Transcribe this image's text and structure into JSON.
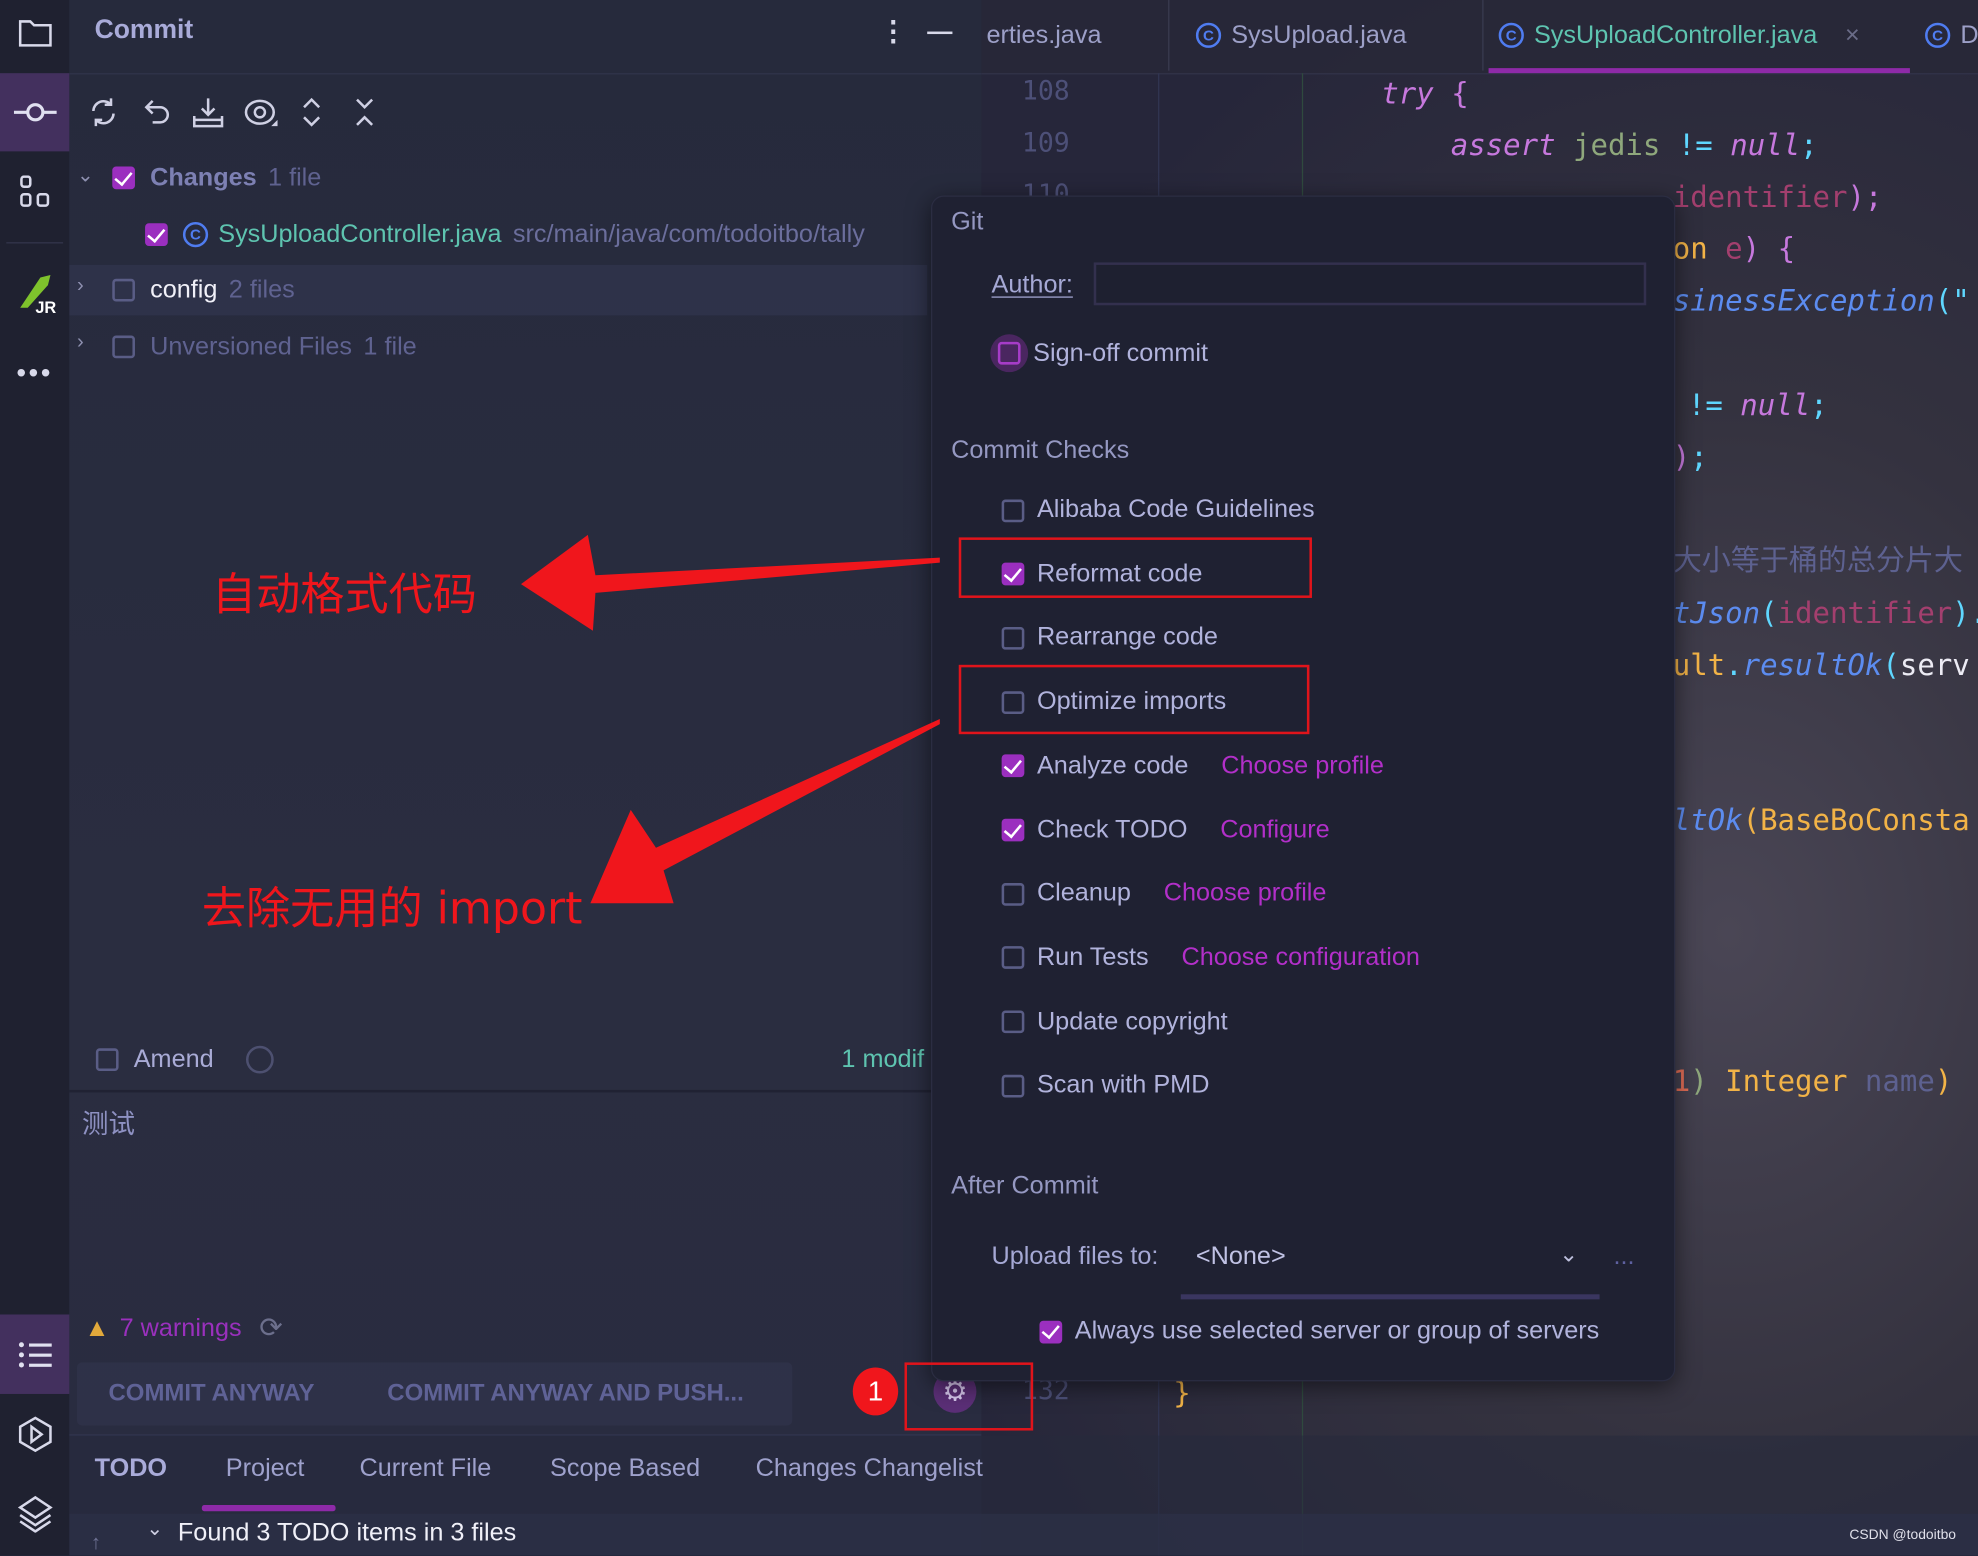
{
  "sidebar": {
    "icons": [
      "folder-icon",
      "commit-icon",
      "structure-icon",
      "jrebel-icon",
      "more-icon",
      "todo-list-icon",
      "run-icon",
      "layers-icon"
    ],
    "jr_label": "JR"
  },
  "commit_panel": {
    "title": "Commit",
    "toolbar": [
      "refresh-icon",
      "rollback-icon",
      "shelve-icon",
      "view-options-icon",
      "expand-all-icon",
      "collapse-all-icon"
    ],
    "tree": [
      {
        "name": "Changes",
        "count": "1 file",
        "checked": true,
        "expanded": true
      },
      {
        "name": "SysUploadController.java",
        "path": "src/main/java/com/todoitbo/tally",
        "checked": true
      },
      {
        "name": "config",
        "count": "2 files",
        "checked": false,
        "expanded": false
      },
      {
        "name": "Unversioned Files",
        "count": "1 file",
        "checked": false,
        "expanded": false
      }
    ],
    "amend_label": "Amend",
    "modified_summary": "1 modif",
    "message": "测试",
    "warnings": "7 warnings",
    "commit_anyway": "COMMIT ANYWAY",
    "commit_anyway_push": "COMMIT ANYWAY AND PUSH..."
  },
  "editor": {
    "tabs": [
      {
        "label": "erties.java",
        "active": false
      },
      {
        "label": "SysUpload.java",
        "active": false
      },
      {
        "label": "SysUploadController.java",
        "active": true
      },
      {
        "label": "D",
        "active": false
      }
    ],
    "line_numbers": [
      "108",
      "109",
      "110",
      "132"
    ],
    "lines": [
      [
        {
          "t": "try",
          "c": "kw"
        },
        {
          "t": " {",
          "c": "br"
        }
      ],
      [
        {
          "t": "assert",
          "c": "kw"
        },
        {
          "t": " jedis",
          "c": "var"
        },
        {
          "t": " !=",
          "c": "op"
        },
        {
          "t": " null",
          "c": "kw"
        },
        {
          "t": ";",
          "c": "op"
        }
      ],
      [
        {
          "t": "identifier",
          "c": "par"
        },
        {
          "t": ");",
          "c": "br"
        }
      ],
      [
        {
          "t": "on",
          "c": "cls"
        },
        {
          "t": " e",
          "c": "par"
        },
        {
          "t": ") {",
          "c": "br"
        }
      ],
      [
        {
          "t": "sinessException",
          "c": "fn"
        },
        {
          "t": "(\"",
          "c": "op"
        }
      ],
      [
        {
          "t": "!=",
          "c": "op"
        },
        {
          "t": " null",
          "c": "kw"
        },
        {
          "t": ";",
          "c": "op"
        }
      ],
      [
        {
          "t": ")",
          "c": "br"
        },
        {
          "t": ";",
          "c": "op"
        }
      ],
      [
        {
          "t": "大小等于桶的总分片大",
          "c": "cm"
        }
      ],
      [
        {
          "t": "tJson",
          "c": "fn"
        },
        {
          "t": "(",
          "c": "op"
        },
        {
          "t": "identifier",
          "c": "par"
        },
        {
          "t": ").",
          "c": "op"
        }
      ],
      [
        {
          "t": "ult",
          "c": "cls"
        },
        {
          "t": ".",
          "c": "op"
        },
        {
          "t": "resultOk",
          "c": "fn"
        },
        {
          "t": "(",
          "c": "op"
        },
        {
          "t": "serv",
          "c": "wh"
        }
      ],
      [
        {
          "t": "ltOk",
          "c": "fn"
        },
        {
          "t": "(BaseBoConsta",
          "c": "cls"
        }
      ],
      [
        {
          "t": "1",
          "c": "num"
        },
        {
          "t": ")",
          "c": "var"
        },
        {
          "t": " Integer",
          "c": "cls"
        },
        {
          "t": " name",
          "c": "cm"
        },
        {
          "t": ")",
          "c": "cls"
        }
      ],
      [
        {
          "t": "}",
          "c": "cls"
        }
      ]
    ]
  },
  "popup": {
    "git_title": "Git",
    "author_label": "Author:",
    "author_value": "",
    "signoff": {
      "label": "Sign-off commit",
      "checked": false
    },
    "checks_title": "Commit Checks",
    "checks": [
      {
        "label": "Alibaba Code Guidelines",
        "checked": false,
        "link": ""
      },
      {
        "label": "Reformat code",
        "checked": true,
        "link": ""
      },
      {
        "label": "Rearrange code",
        "checked": false,
        "link": ""
      },
      {
        "label": "Optimize imports",
        "checked": false,
        "link": ""
      },
      {
        "label": "Analyze code",
        "checked": true,
        "link": "Choose profile"
      },
      {
        "label": "Check TODO",
        "checked": true,
        "link": "Configure"
      },
      {
        "label": "Cleanup",
        "checked": false,
        "link": "Choose profile"
      },
      {
        "label": "Run Tests",
        "checked": false,
        "link": "Choose configuration"
      },
      {
        "label": "Update copyright",
        "checked": false,
        "link": ""
      },
      {
        "label": "Scan with PMD",
        "checked": false,
        "link": ""
      }
    ],
    "after_title": "After Commit",
    "upload_label": "Upload files to:",
    "upload_value": "<None>",
    "more_label": "...",
    "always_use": {
      "label": "Always use selected server or group of servers",
      "checked": true
    }
  },
  "annotations": {
    "reformat_note": "自动格式代码",
    "imports_note": "去除无用的 import",
    "badge": "1",
    "color": "#f0161c"
  },
  "bottom": {
    "tabs": [
      {
        "label": "TODO",
        "bold": true
      },
      {
        "label": "Project",
        "active": true
      },
      {
        "label": "Current File"
      },
      {
        "label": "Scope Based"
      },
      {
        "label": "Changes Changelist"
      }
    ],
    "found": "Found 3 TODO items in 3 files"
  },
  "watermark": "CSDN @todoitbo",
  "colors": {
    "accent": "#9b2fbf",
    "link": "#b22fc9",
    "file_green": "#5ec4b0",
    "class_blue": "#4f7cf0",
    "warning": "#e2a93b"
  }
}
